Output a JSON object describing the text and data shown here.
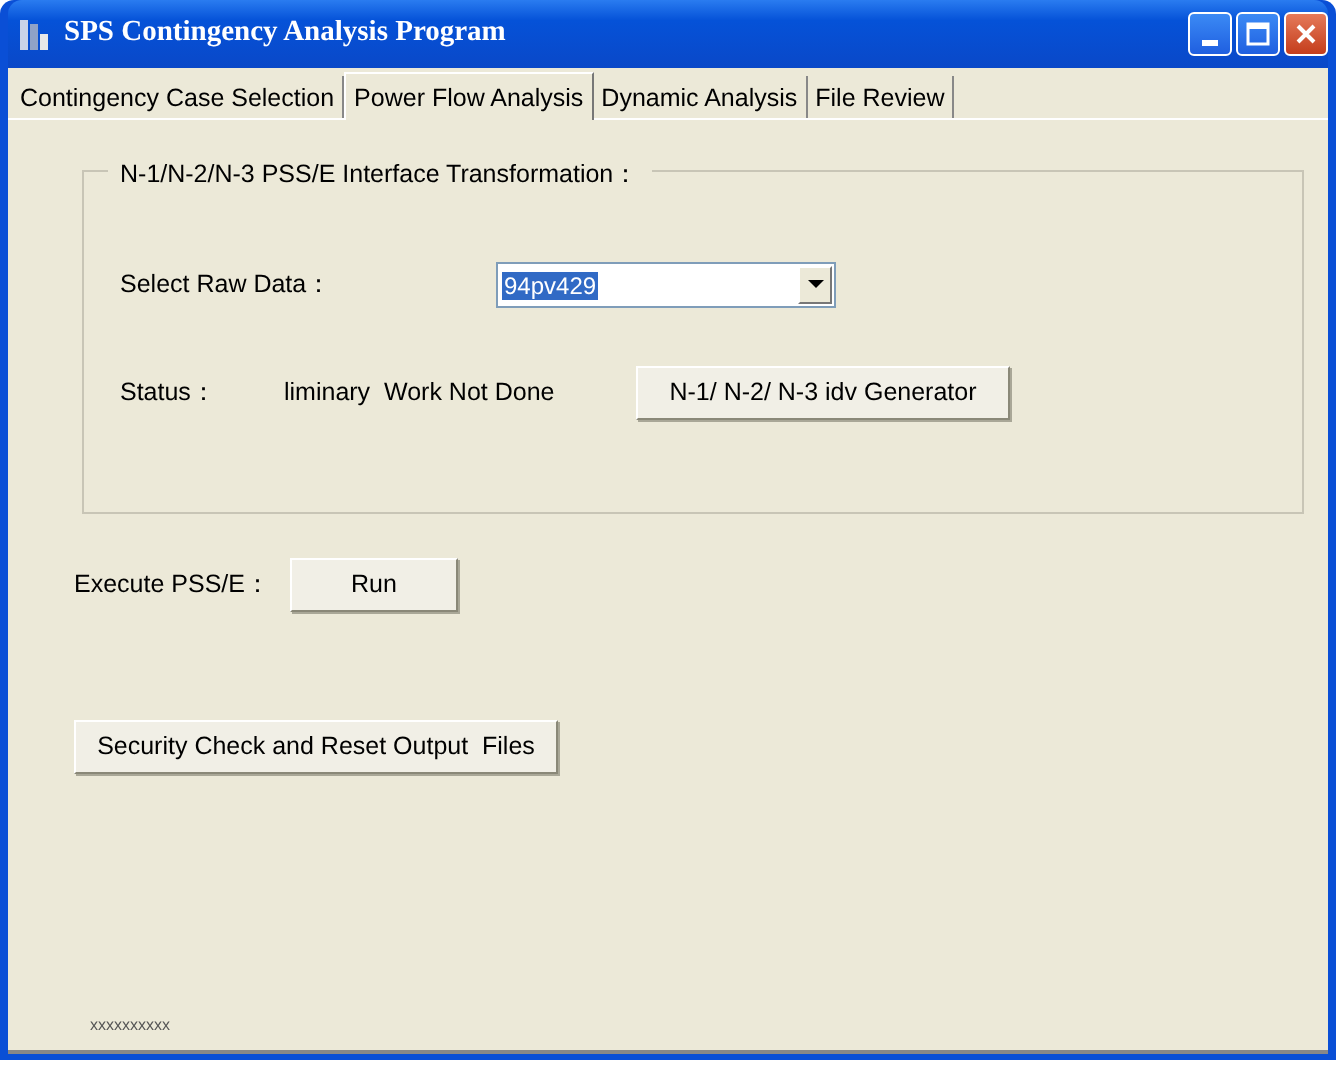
{
  "window": {
    "title": "SPS Contingency Analysis Program"
  },
  "tabs": [
    {
      "label": "Contingency Case Selection",
      "selected": false
    },
    {
      "label": "Power Flow Analysis",
      "selected": true
    },
    {
      "label": "Dynamic Analysis",
      "selected": false
    },
    {
      "label": "File Review",
      "selected": false
    }
  ],
  "group": {
    "title": "N-1/N-2/N-3 PSS/E Interface Transformation：",
    "raw_data": {
      "label": "Select Raw Data：",
      "value": "94pv429",
      "text_selected": true
    },
    "status": {
      "label": "Status：",
      "value": "liminary  Work Not Done"
    },
    "button": "N-1/ N-2/ N-3 idv Generator"
  },
  "execute": {
    "label": "Execute PSS/E：",
    "button": "Run"
  },
  "security_button": "Security Check and Reset Output  Files",
  "footer": "xxxxxxxxxx"
}
